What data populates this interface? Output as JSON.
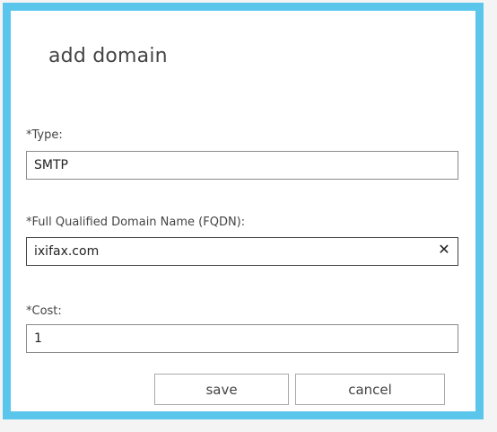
{
  "dialog": {
    "title": "add domain",
    "accent_color": "#5bc6ec"
  },
  "fields": {
    "type": {
      "label": "*Type:",
      "value": "SMTP"
    },
    "fqdn": {
      "label": "*Full Qualified Domain Name (FQDN):",
      "value": "ixifax.com",
      "clear_icon": "close-icon",
      "clear_glyph": "✕"
    },
    "cost": {
      "label": "*Cost:",
      "value": "1"
    }
  },
  "buttons": {
    "save_label": "save",
    "cancel_label": "cancel"
  }
}
